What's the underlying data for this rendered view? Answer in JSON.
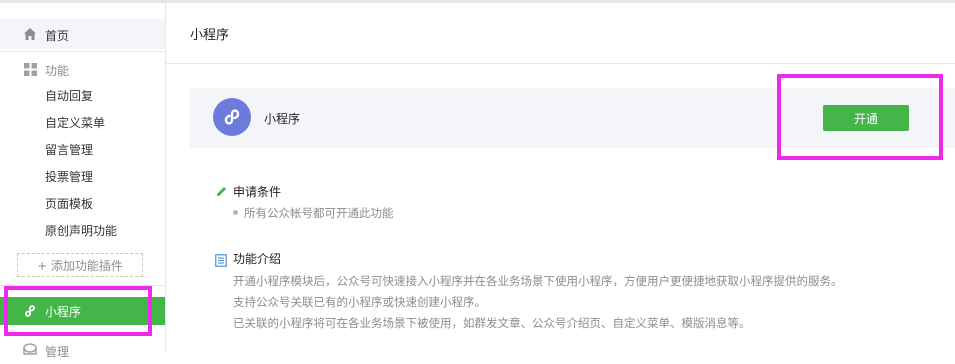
{
  "sidebar": {
    "home_label": "首页",
    "function_label": "功能",
    "sub_items": [
      "自动回复",
      "自定义菜单",
      "留言管理",
      "投票管理",
      "页面模板",
      "原创声明功能"
    ],
    "add_plugin_label": "+ 添加功能插件",
    "mini_program_label": "小程序",
    "manage_label": "管理"
  },
  "main": {
    "title": "小程序",
    "card": {
      "title": "小程序",
      "open_button": "开通"
    },
    "conditions": {
      "title": "申请条件",
      "text": "所有公众帐号都可开通此功能"
    },
    "intro": {
      "title": "功能介绍",
      "lines": [
        "开通小程序模块后，公众号可快速接入小程序并在各业务场景下使用小程序，方便用户更便捷地获取小程序提供的服务。",
        "支持公众号关联已有的小程序或快速创建小程序。",
        "已关联的小程序将可在各业务场景下被使用，如群发文章、公众号介绍页、自定义菜单、模版消息等。"
      ]
    }
  },
  "colors": {
    "accent_green": "#44b549",
    "highlight_pink": "#ee29ee",
    "logo_blue": "#6c7bdb",
    "card_bg": "#f4f5f9"
  }
}
